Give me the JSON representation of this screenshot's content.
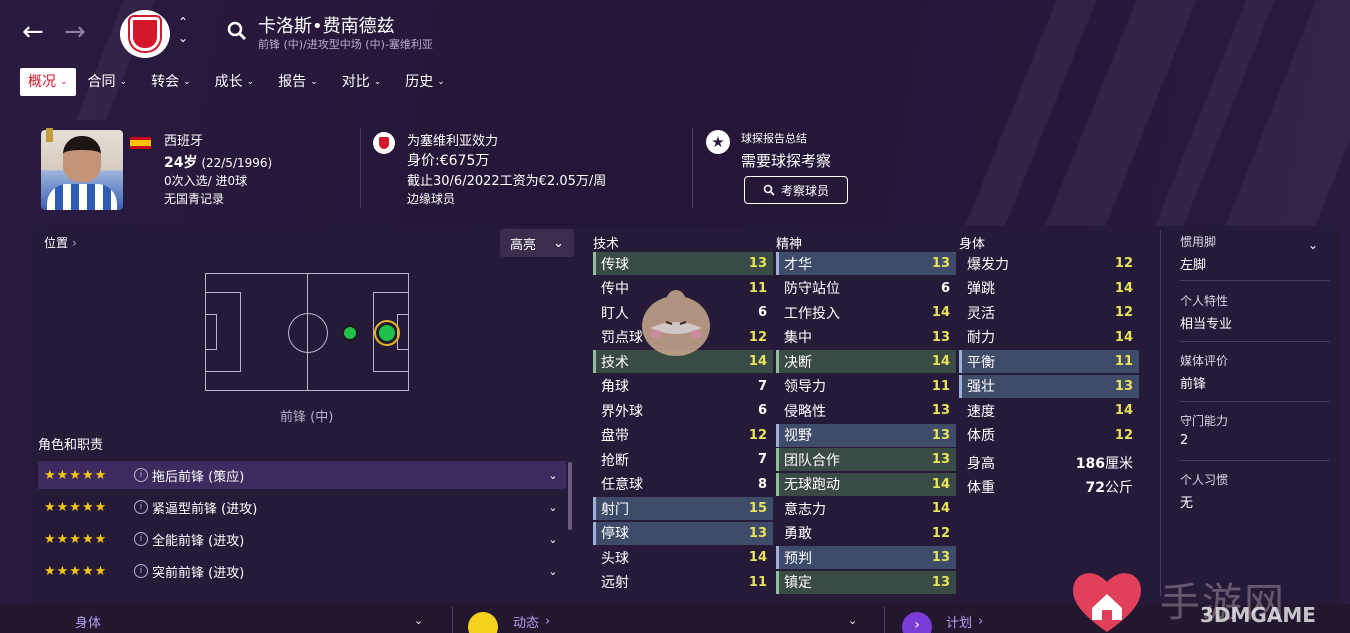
{
  "header": {
    "player_name": "卡洛斯•费南德兹",
    "player_positions": "前锋 (中)/进攻型中场 (中)-塞维利亚"
  },
  "tabs": [
    {
      "label": "概况"
    },
    {
      "label": "合同"
    },
    {
      "label": "转会"
    },
    {
      "label": "成长"
    },
    {
      "label": "报告"
    },
    {
      "label": "对比"
    },
    {
      "label": "历史"
    }
  ],
  "info": {
    "nation": "西班牙",
    "age": "24岁",
    "dob": "(22/5/1996)",
    "caps": "0次入选/ 进0球",
    "youth": "无国青记录",
    "club": "为塞维利亚效力",
    "value": "身价:€675万",
    "contract": "截止30/6/2022工资为€2.05万/周",
    "squad_role": "边缘球员",
    "scout_title": "球探报告总结",
    "scout_need": "需要球探考察",
    "scout_button": "考察球员"
  },
  "position_panel": {
    "title": "位置",
    "highlight": "高亮",
    "position_name": "前锋 (中)"
  },
  "roles": {
    "title": "角色和职责",
    "items": [
      {
        "stars": "★★★★★",
        "name": "拖后前锋 (策应)",
        "rating": 4.5
      },
      {
        "stars": "★★★★★",
        "name": "紧逼型前锋 (进攻)",
        "rating": 4.5
      },
      {
        "stars": "★★★★★",
        "name": "全能前锋 (进攻)",
        "rating": 4.5
      },
      {
        "stars": "★★★★★",
        "name": "突前前锋 (进攻)",
        "rating": 4.5
      }
    ]
  },
  "attributes": {
    "technical_title": "技术",
    "mental_title": "精神",
    "physical_title": "身体",
    "technical": [
      {
        "name": "传球",
        "value": "13"
      },
      {
        "name": "传中",
        "value": "11"
      },
      {
        "name": "盯人",
        "value": "6"
      },
      {
        "name": "罚点球",
        "value": "12"
      },
      {
        "name": "技术",
        "value": "14"
      },
      {
        "name": "角球",
        "value": "7"
      },
      {
        "name": "界外球",
        "value": "6"
      },
      {
        "name": "盘带",
        "value": "12"
      },
      {
        "name": "抢断",
        "value": "7"
      },
      {
        "name": "任意球",
        "value": "8"
      },
      {
        "name": "射门",
        "value": "15"
      },
      {
        "name": "停球",
        "value": "13"
      },
      {
        "name": "头球",
        "value": "14"
      },
      {
        "name": "远射",
        "value": "11"
      }
    ],
    "mental": [
      {
        "name": "才华",
        "value": "13"
      },
      {
        "name": "防守站位",
        "value": "6"
      },
      {
        "name": "工作投入",
        "value": "14"
      },
      {
        "name": "集中",
        "value": "13"
      },
      {
        "name": "决断",
        "value": "14"
      },
      {
        "name": "领导力",
        "value": "11"
      },
      {
        "name": "侵略性",
        "value": "13"
      },
      {
        "name": "视野",
        "value": "13"
      },
      {
        "name": "团队合作",
        "value": "13"
      },
      {
        "name": "无球跑动",
        "value": "14"
      },
      {
        "name": "意志力",
        "value": "14"
      },
      {
        "name": "勇敢",
        "value": "12"
      },
      {
        "name": "预判",
        "value": "13"
      },
      {
        "name": "镇定",
        "value": "13"
      }
    ],
    "physical": [
      {
        "name": "爆发力",
        "value": "12"
      },
      {
        "name": "弹跳",
        "value": "14"
      },
      {
        "name": "灵活",
        "value": "12"
      },
      {
        "name": "耐力",
        "value": "14"
      },
      {
        "name": "平衡",
        "value": "11"
      },
      {
        "name": "强壮",
        "value": "13"
      },
      {
        "name": "速度",
        "value": "14"
      },
      {
        "name": "体质",
        "value": "12"
      }
    ],
    "height_label": "身高",
    "height_value": "186",
    "height_unit": "厘米",
    "weight_label": "体重",
    "weight_value": "72",
    "weight_unit": "公斤"
  },
  "side": {
    "foot_label": "惯用脚",
    "foot_value": "左脚",
    "personality_label": "个人特性",
    "personality_value": "相当专业",
    "media_label": "媒体评价",
    "media_value": "前锋",
    "gk_label": "守门能力",
    "gk_value": "2",
    "habits_label": "个人习惯",
    "habits_value": "无"
  },
  "bottom": {
    "tab1": "身体",
    "tab2": "动态",
    "tab3": "计划"
  },
  "watermark": {
    "text": "3DMGAME"
  },
  "colors": {
    "accent_red": "#d4172b",
    "value_yellow": "#e9e35a",
    "highlight_blue": "#3e4c6a",
    "star_gold": "#f5c518"
  }
}
